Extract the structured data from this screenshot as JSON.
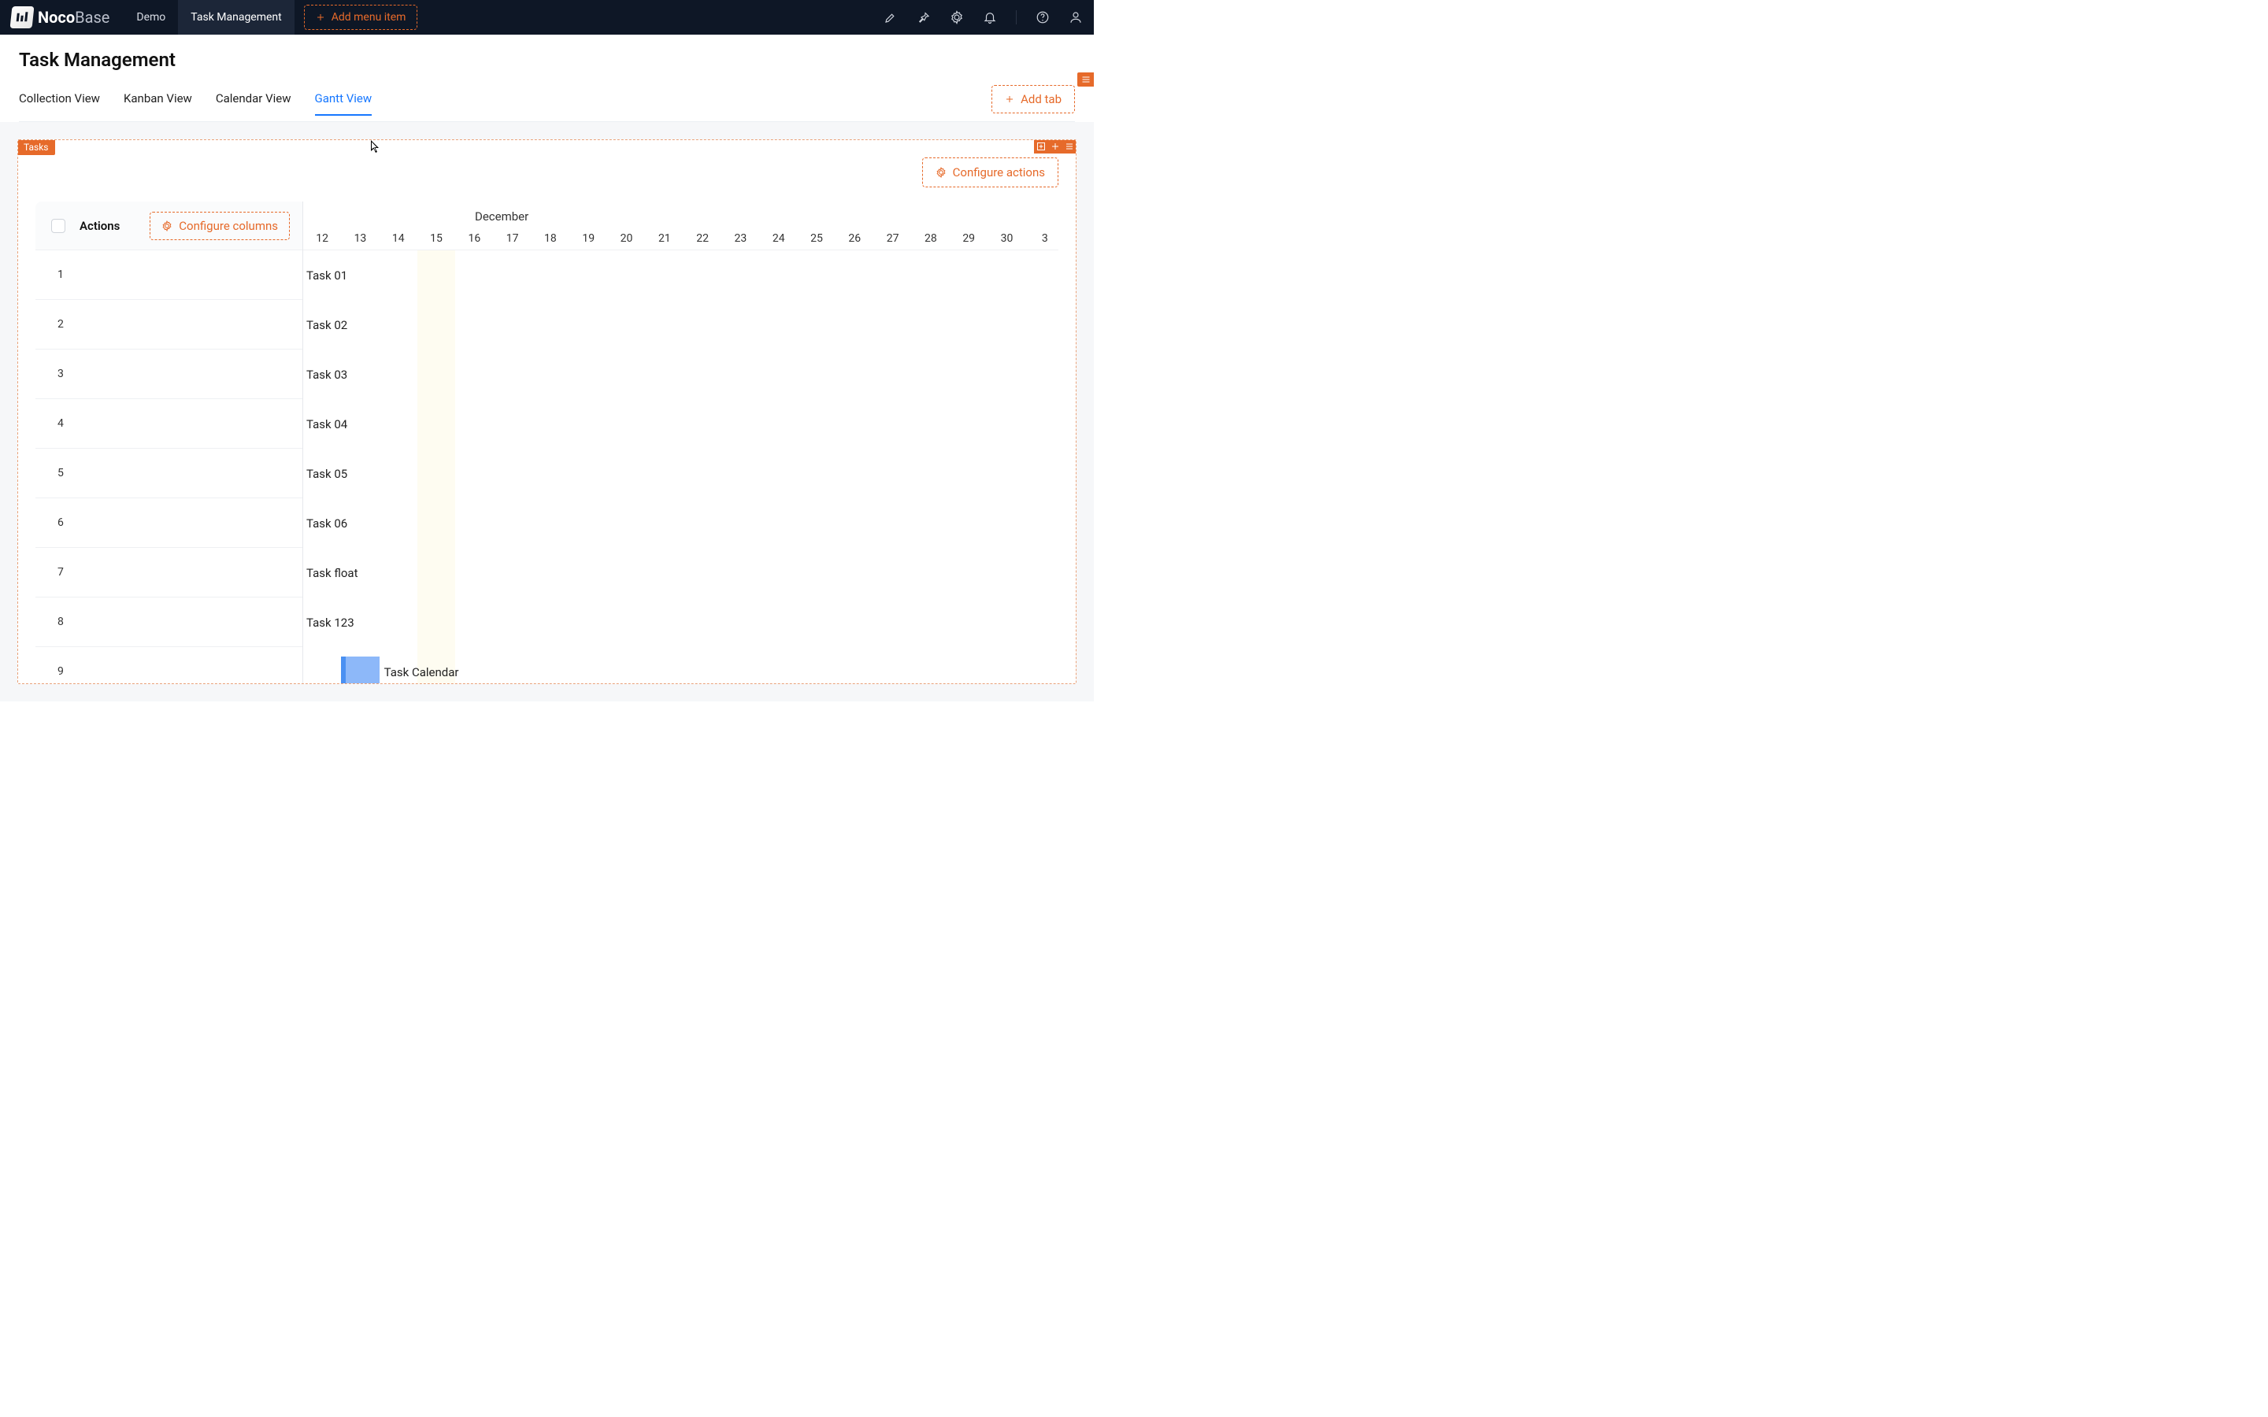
{
  "brand": {
    "name_bold": "Noco",
    "name_light": "Base"
  },
  "nav": {
    "items": [
      {
        "label": "Demo",
        "active": false
      },
      {
        "label": "Task Management",
        "active": true
      }
    ],
    "add_menu_label": "Add menu item"
  },
  "page": {
    "title": "Task Management",
    "tabs": [
      {
        "label": "Collection View",
        "active": false
      },
      {
        "label": "Kanban View",
        "active": false
      },
      {
        "label": "Calendar View",
        "active": false
      },
      {
        "label": "Gantt View",
        "active": true
      }
    ],
    "add_tab_label": "Add tab"
  },
  "card": {
    "badge": "Tasks",
    "configure_actions_label": "Configure actions",
    "configure_columns_label": "Configure columns",
    "actions_header": "Actions"
  },
  "timeline": {
    "month": "December",
    "today_index": 3,
    "days": [
      "12",
      "13",
      "14",
      "15",
      "16",
      "17",
      "18",
      "19",
      "20",
      "21",
      "22",
      "23",
      "24",
      "25",
      "26",
      "27",
      "28",
      "29",
      "30",
      "3"
    ]
  },
  "rows": [
    {
      "n": "1",
      "name": "Task 01"
    },
    {
      "n": "2",
      "name": "Task 02"
    },
    {
      "n": "3",
      "name": "Task 03"
    },
    {
      "n": "4",
      "name": "Task 04"
    },
    {
      "n": "5",
      "name": "Task 05"
    },
    {
      "n": "6",
      "name": "Task 06"
    },
    {
      "n": "7",
      "name": "Task float"
    },
    {
      "n": "8",
      "name": "Task 123"
    },
    {
      "n": "9",
      "name": "Task Calendar"
    }
  ],
  "bars": [
    {
      "row": 8,
      "start_day_index": 1,
      "span_days": 1
    }
  ]
}
